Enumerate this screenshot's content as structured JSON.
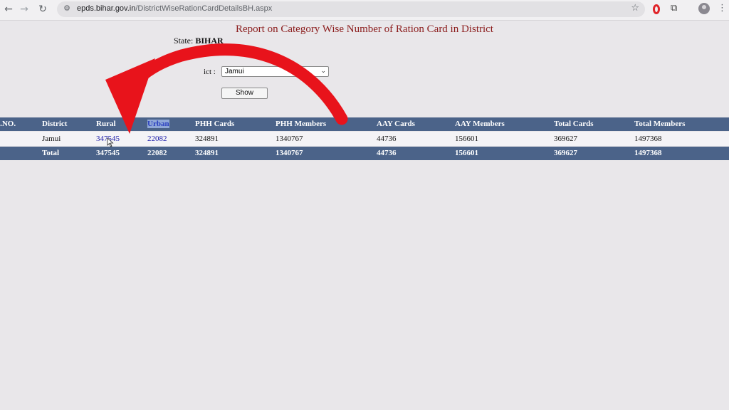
{
  "browser": {
    "url_host": "epds.bihar.gov.in",
    "url_path": "/DistrictWiseRationCardDetailsBH.aspx"
  },
  "page": {
    "title": "Report on Category Wise Number of Ration Card in District",
    "state_prefix": "State: ",
    "state_value": "BIHAR",
    "district_label": "ict :",
    "district_selected": "Jamui",
    "show_button": "Show"
  },
  "table": {
    "headers": [
      "S.NO.",
      "District",
      "Rural",
      "Urban",
      "PHH Cards",
      "PHH Members",
      "AAY Cards",
      "AAY Members",
      "Total Cards",
      "Total Members"
    ],
    "rows": [
      [
        "",
        "Jamui",
        "347545",
        "22082",
        "324891",
        "1340767",
        "44736",
        "156601",
        "369627",
        "1497368"
      ]
    ],
    "total": [
      "",
      "Total",
      "347545",
      "22082",
      "324891",
      "1340767",
      "44736",
      "156601",
      "369627",
      "1497368"
    ]
  },
  "colors": {
    "header_bg": "#4b6389",
    "title_color": "#8b1c1c",
    "arrow_color": "#e8131b"
  },
  "icons": {
    "back": "arrow-left-icon",
    "forward": "arrow-right-icon",
    "reload": "reload-icon",
    "site_info": "tune-icon",
    "bookmark": "star-icon",
    "extensions": "puzzle-icon",
    "menu": "kebab-menu-icon"
  }
}
